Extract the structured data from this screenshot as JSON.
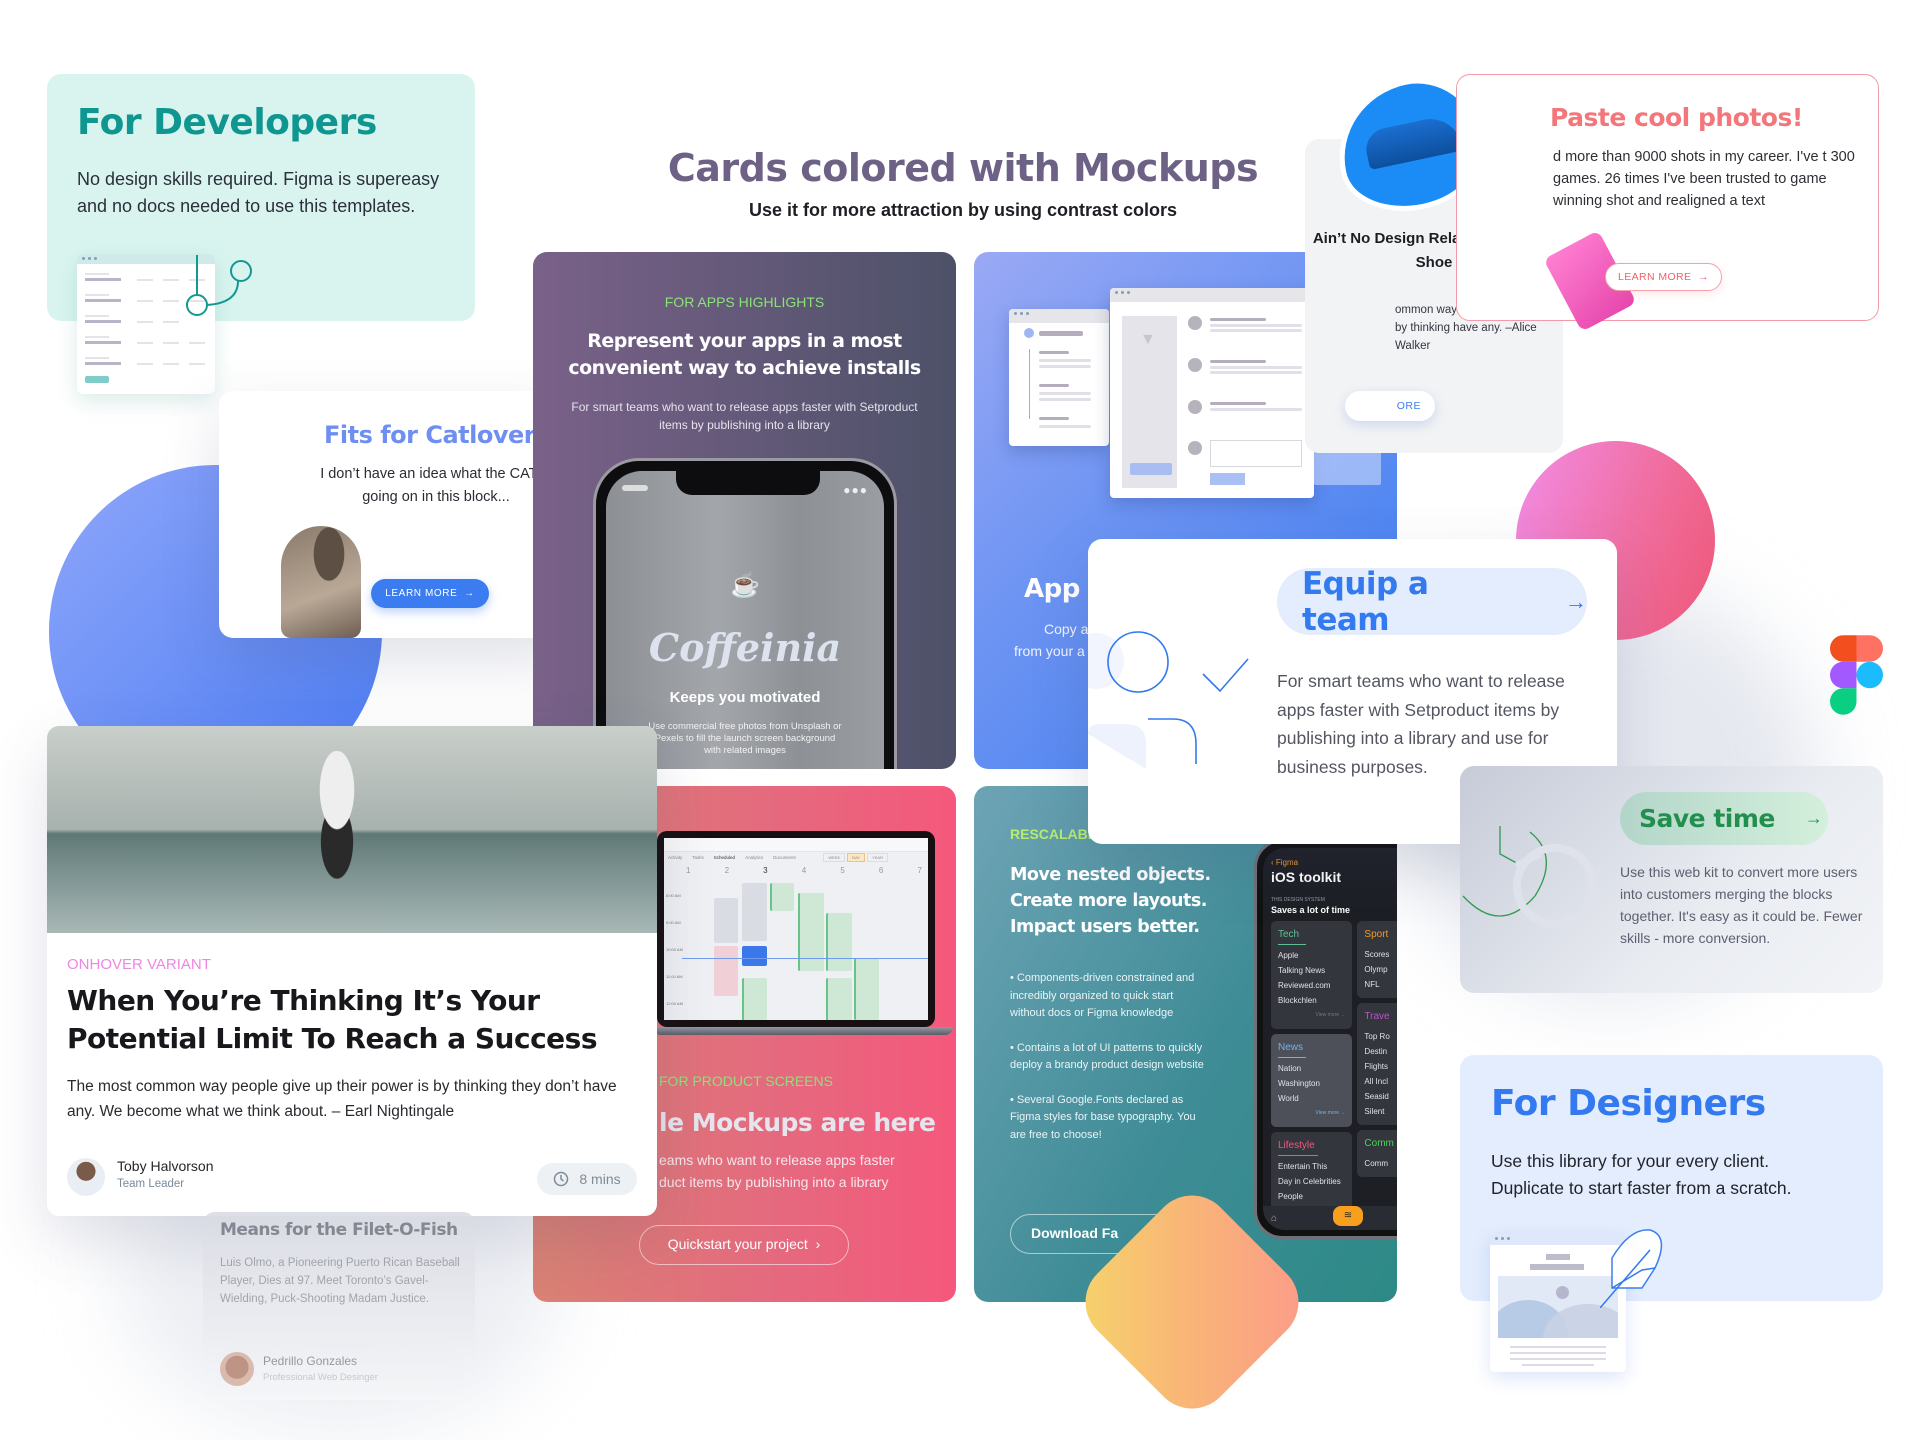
{
  "header": {
    "title": "Cards colored with Mockups",
    "subtitle": "Use it for more attraction by using contrast colors"
  },
  "developers_card": {
    "title": "For Developers",
    "description": "No design skills required. Figma is supereasy and no docs needed to use this templates."
  },
  "catlovers_card": {
    "title": "Fits for Catlovers",
    "description": "I don’t have an idea what the CAT is going on in this block...",
    "button_label": "LEARN MORE"
  },
  "apps_card": {
    "eyebrow": "FOR APPS HIGHLIGHTS",
    "heading": "Represent your apps in a most convenient way to achieve installs",
    "description": "For smart teams who want to release apps faster with Setproduct items by publishing into a library",
    "phone": {
      "app_name": "Coffeinia",
      "tagline": "Keeps you motivated",
      "caption": "Use commercial free photos from Unsplash or Pexels to fill the launch screen background with related images",
      "icon": "coffee-cup-icon"
    }
  },
  "app_ui_card": {
    "heading": "App U",
    "description_line1": "Copy and",
    "description_line2": "from your a"
  },
  "product_card": {
    "eyebrow": "FOR PRODUCT SCREENS",
    "heading": "le Mockups are here",
    "description_line1": "eams who want to release apps faster",
    "description_line2": "duct items by publishing into a library",
    "button_label": "Quickstart your project",
    "calendar": {
      "tabs": [
        "Activity",
        "Tasks",
        "Scheduled",
        "Analytics",
        "Documents"
      ],
      "views": [
        "WEEK",
        "DAY",
        "YEAR"
      ],
      "active_view": "DAY",
      "days": [
        "1",
        "2",
        "3",
        "4",
        "5",
        "6",
        "7"
      ],
      "times": [
        "8:00 AM",
        "9:00 AM",
        "10:00 AM",
        "10:30 AM",
        "11:00 AM",
        "12:00 AM",
        "1:00 PM"
      ]
    }
  },
  "rescalable_card": {
    "eyebrow": "RESCALABLE",
    "heading": "Move nested objects. Create more layouts. Impact users better.",
    "bullets": [
      "• Components-driven constrained and incredibly organized to quick start without docs or Figma knowledge",
      "• Contains a lot of UI patterns to quickly deploy a brandy product design website",
      "• Several Google.Fonts declared as Figma styles for base typography. You are free to choose!"
    ],
    "button_label": "Download Fa",
    "ios": {
      "back_label": "Figma",
      "title": "iOS toolkit",
      "kicker": "THIS DESIGN SYSTEM",
      "subtitle": "Saves a lot of time",
      "tiles": [
        {
          "title": "Tech",
          "color": "#5fbf93",
          "items": [
            "Apple",
            "Talking News",
            "Reviewed.com",
            "Blockchlen"
          ],
          "more": "View more →"
        },
        {
          "title": "News",
          "color": "#6fb2ea",
          "items": [
            "Nation",
            "Washington",
            "World"
          ],
          "more": "View more →"
        },
        {
          "title": "Lifestyle",
          "color": "#f0587a",
          "items": [
            "Entertain This",
            "Day in Celebrities",
            "People"
          ],
          "more": ""
        }
      ],
      "tiles_right": [
        {
          "title": "Sport",
          "color": "#f09a2a",
          "items": [
            "Scores",
            "Olymp",
            "NFL"
          ]
        },
        {
          "title": "Trave",
          "color": "#c04fd0",
          "items": [
            "Top Ro",
            "Destin",
            "Flights",
            "All Incl",
            "Seasid",
            "Silent"
          ]
        },
        {
          "title": "Comm",
          "color": "#4cd05a",
          "items": [
            "Comm"
          ]
        }
      ]
    }
  },
  "article_card": {
    "eyebrow": "ONHOVER VARIANT",
    "title": "When You’re Thinking It’s Your Potential Limit To Reach a Success",
    "description": "The most common way people give up their power is by thinking they don’t have any. We become what we think about. – Earl Nightingale",
    "author_name": "Toby Halvorson",
    "author_role": "Team Leader",
    "read_time": "8 mins"
  },
  "filet_card": {
    "title": "Means for the Filet-O-Fish",
    "description": "Luis Olmo, a Pioneering Puerto Rican Baseball Player, Dies at 97. Meet Toronto’s Gavel-Wielding, Puck-Shooting Madam Justice.",
    "author_name": "Pedrillo Gonzales",
    "author_role": "Professional Web Desinger"
  },
  "shoe_card": {
    "title": "Ain’t No Design Related Without a Shoe",
    "description": "ommon way people ir power is by thinking have any. –Alice Walker",
    "button_label": "ORE"
  },
  "photos_card": {
    "title": "Paste cool photos!",
    "description": "d more than 9000 shots in my career. I've t 300 games. 26 times I've been trusted to game winning shot and realigned a text",
    "button_label": "LEARN MORE"
  },
  "equip_card": {
    "title": "Equip a team",
    "description": "For smart teams who want to release apps faster with Setproduct items by publishing into a library and use for business purposes."
  },
  "save_card": {
    "title": "Save time",
    "description": "Use this web kit to convert more users into customers merging the blocks together. It's easy as it could be. Fewer skills - more conversion."
  },
  "designers_card": {
    "title": "For Designers",
    "description_line1": "Use this library for your every client.",
    "description_line2": "Duplicate to start faster from a scratch."
  },
  "colors": {
    "developers_accent": "#0f9690",
    "designers_accent": "#3379ef",
    "save_accent": "#238f4e",
    "photos_accent": "#f3767b",
    "eyebrow_green": "#8ee07a",
    "onhover_pink": "#ee86e3"
  }
}
